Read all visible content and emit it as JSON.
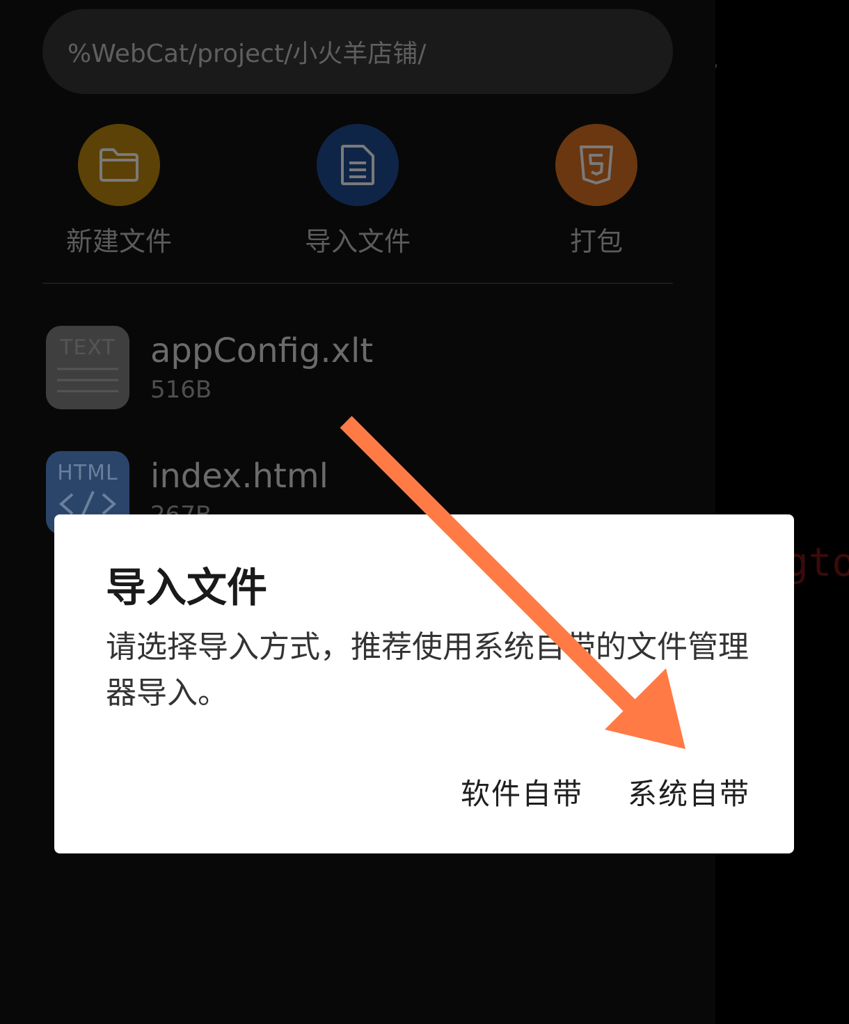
{
  "path_bar": {
    "text": "%WebCat/project/小火羊店铺/"
  },
  "actions": [
    {
      "label": "新建文件",
      "icon": "folder-icon",
      "color": "#5c4206"
    },
    {
      "label": "导入文件",
      "icon": "document-icon",
      "color": "#0f2547"
    },
    {
      "label": "打包",
      "icon": "html5-icon",
      "color": "#6a3710"
    }
  ],
  "files": [
    {
      "name": "appConfig.xlt",
      "size": "516B",
      "badge": "TEXT",
      "icon": "text-file-icon",
      "color": "#3f3f3f"
    },
    {
      "name": "index.html",
      "size": "267B",
      "badge": "HTML",
      "icon": "html-file-icon",
      "color": "#2a4569"
    }
  ],
  "dialog": {
    "title": "导入文件",
    "message": "请选择导入方式，推荐使用系统自带的文件管理器导入。",
    "buttons": {
      "app_builtin": "软件自带",
      "system_builtin": "系统自带"
    }
  },
  "background_peek": {
    "code_fragment": "gto"
  },
  "colors": {
    "accent_arrow": "#ff7a45",
    "dialog_bg": "#ffffff",
    "drawer_bg": "#080808"
  }
}
